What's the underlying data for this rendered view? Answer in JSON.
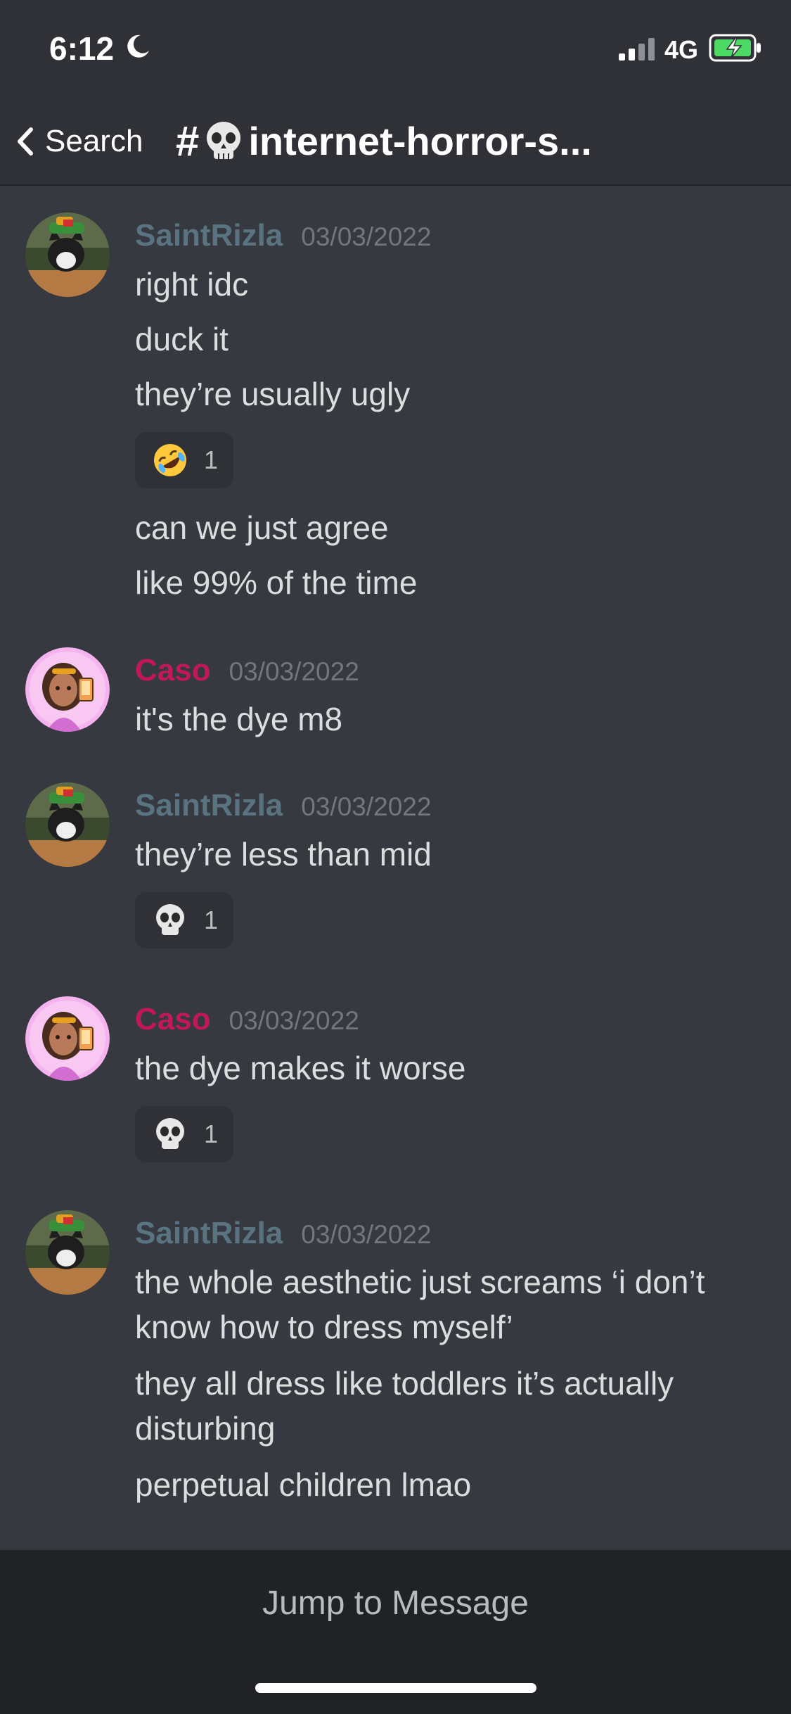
{
  "status": {
    "time": "6:12",
    "network": "4G"
  },
  "nav": {
    "back_label": "Search",
    "hash": "#",
    "channel_name": "internet-horror-s..."
  },
  "messages": [
    {
      "author": "SaintRizla",
      "time": "03/03/2022",
      "lines": [
        "right idc",
        "duck it",
        "they’re usually ugly",
        "can we just agree",
        "like 99% of the time"
      ],
      "reaction": {
        "emoji": "rolling-on-floor-laughing-emoji",
        "count": "1"
      }
    },
    {
      "author": "Caso",
      "time": "03/03/2022",
      "lines": [
        "it's the dye m8"
      ]
    },
    {
      "author": "SaintRizla",
      "time": "03/03/2022",
      "lines": [
        "they’re less than mid"
      ],
      "reaction": {
        "emoji": "skull-emoji",
        "count": "1"
      }
    },
    {
      "author": "Caso",
      "time": "03/03/2022",
      "lines": [
        "the dye makes it worse"
      ],
      "reaction": {
        "emoji": "skull-emoji",
        "count": "1"
      }
    },
    {
      "author": "SaintRizla",
      "time": "03/03/2022",
      "lines": [
        "the whole aesthetic just screams ‘i don’t know how to dress myself’",
        "they all dress like toddlers it’s actually disturbing",
        "perpetual children lmao"
      ]
    }
  ],
  "footer": {
    "jump_label": "Jump to Message"
  },
  "colors": {
    "background": "#36393f",
    "bar": "#2f3136",
    "saint_name": "#5a7380",
    "caso_name": "#c2185b"
  }
}
